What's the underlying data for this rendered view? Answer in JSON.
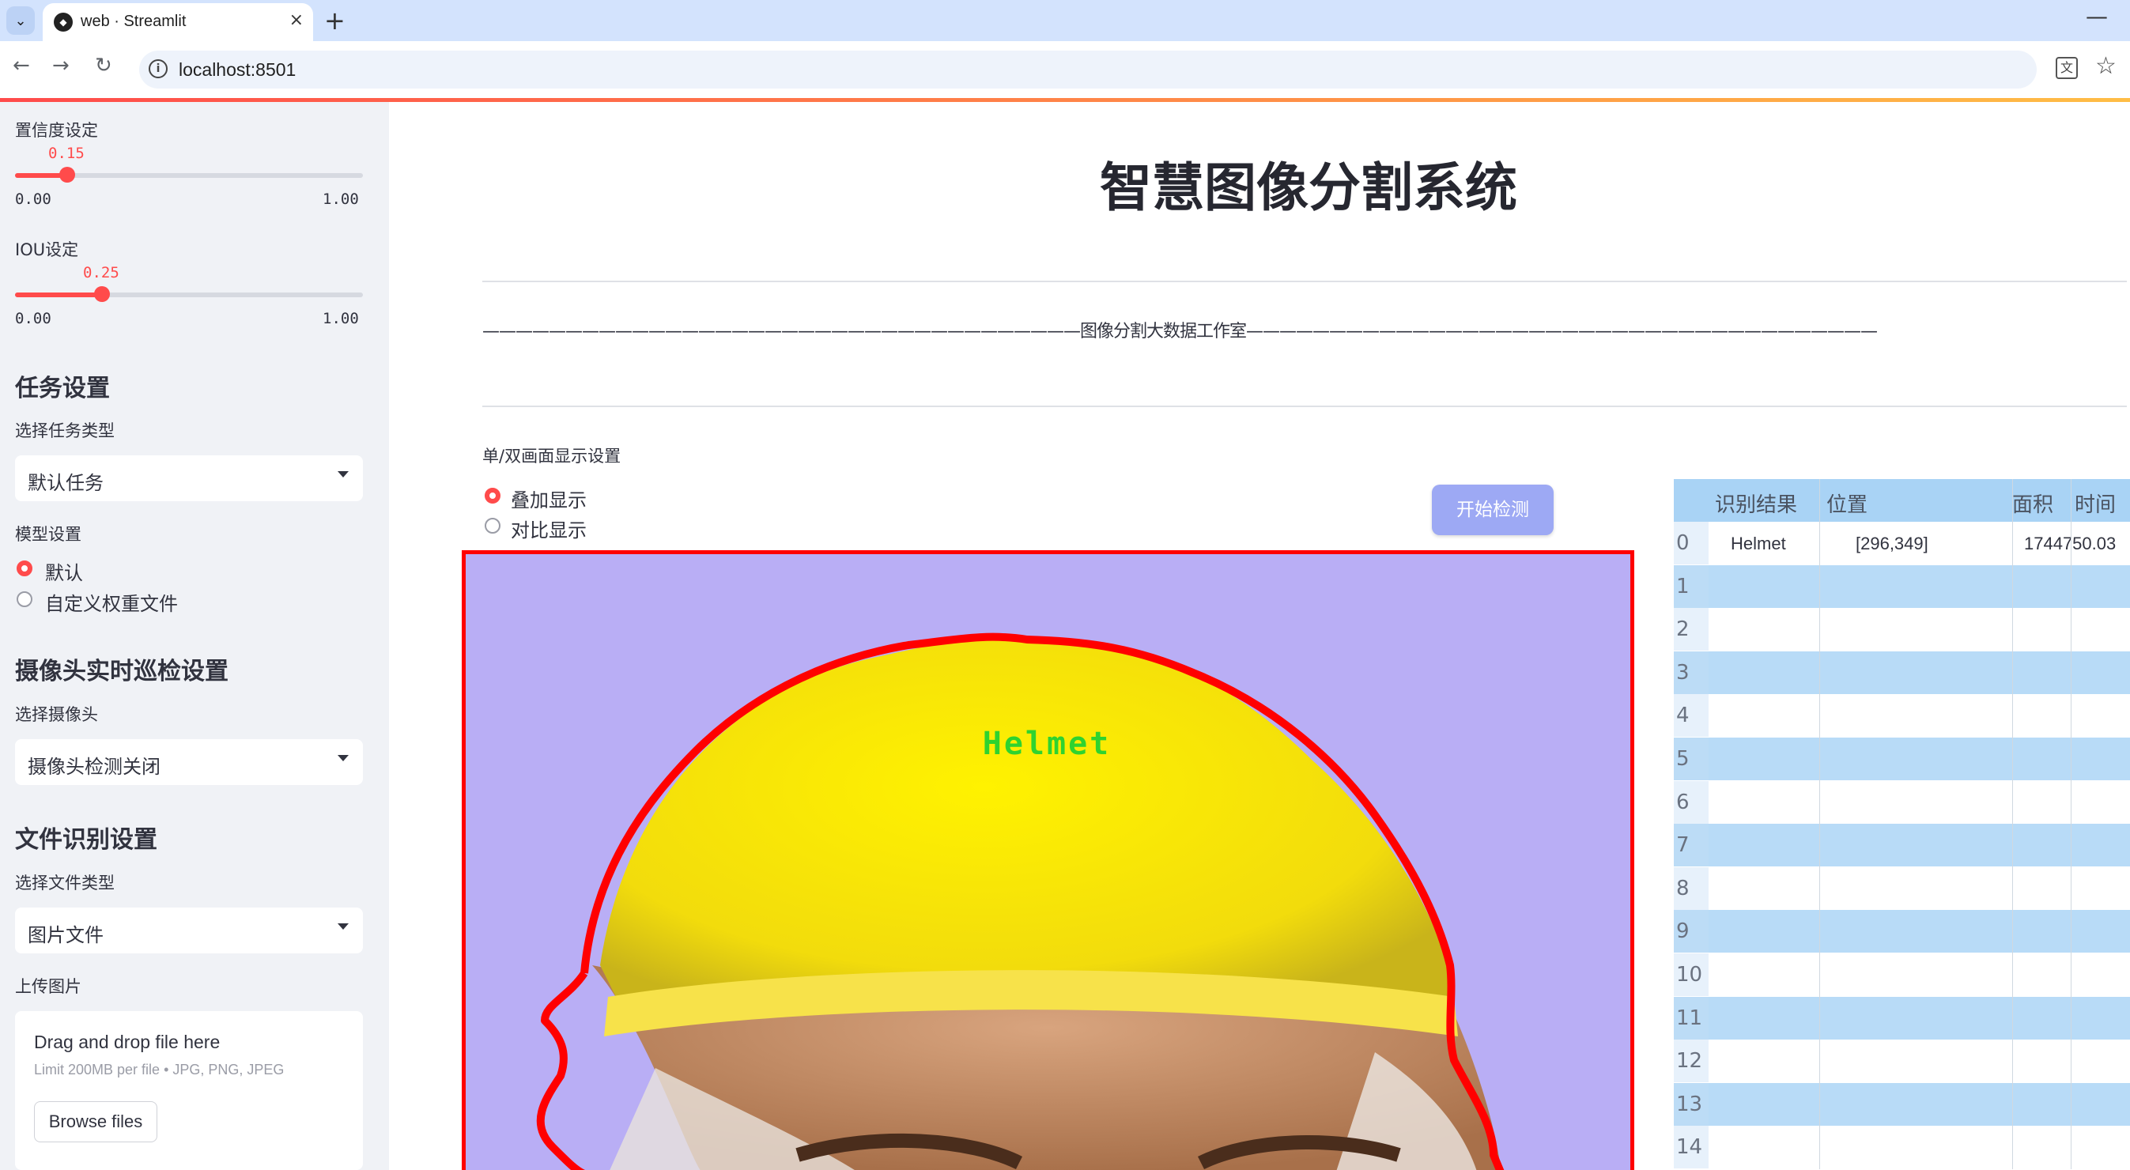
{
  "browser": {
    "tab_title": "web · Streamlit",
    "url": "localhost:8501",
    "new_tab_symbol": "+",
    "close_symbol": "×"
  },
  "sidebar": {
    "confidence": {
      "label": "置信度设定",
      "value": "0.15",
      "min": "0.00",
      "max": "1.00",
      "fraction": 0.15
    },
    "iou": {
      "label": "IOU设定",
      "value": "0.25",
      "min": "0.00",
      "max": "1.00",
      "fraction": 0.25
    },
    "task_heading": "任务设置",
    "task_type_label": "选择任务类型",
    "task_type_value": "默认任务",
    "model_label": "模型设置",
    "model_options": [
      "默认",
      "自定义权重文件"
    ],
    "model_selected": 0,
    "camera_heading": "摄像头实时巡检设置",
    "camera_label": "选择摄像头",
    "camera_value": "摄像头检测关闭",
    "file_heading": "文件识别设置",
    "file_type_label": "选择文件类型",
    "file_type_value": "图片文件",
    "upload_label": "上传图片",
    "upload_main": "Drag and drop file here",
    "upload_sub": "Limit 200MB per file • JPG, PNG, JPEG",
    "browse_label": "Browse files"
  },
  "main": {
    "title": "智慧图像分割系统",
    "subtitle": "————————————————————————————————————图像分割大数据工作室——————————————————————————————————————",
    "display_label": "单/双画面显示设置",
    "display_options": [
      "叠加显示",
      "对比显示"
    ],
    "display_selected": 0,
    "start_button": "开始检测",
    "detection_label": "Helmet"
  },
  "table": {
    "headers": [
      "识别结果",
      "位置",
      "面积",
      "时间"
    ],
    "rows": [
      {
        "index": "0",
        "result": "Helmet",
        "position": "[296,349]",
        "area": "1744750.03"
      },
      {
        "index": "1"
      },
      {
        "index": "2"
      },
      {
        "index": "3"
      },
      {
        "index": "4"
      },
      {
        "index": "5"
      },
      {
        "index": "6"
      },
      {
        "index": "7"
      },
      {
        "index": "8"
      },
      {
        "index": "9"
      },
      {
        "index": "10"
      },
      {
        "index": "11"
      },
      {
        "index": "12"
      },
      {
        "index": "13"
      },
      {
        "index": "14"
      }
    ]
  },
  "colors": {
    "accent": "#ff4b4b",
    "button": "#9da9f4",
    "segment_outline": "#ff0000",
    "helmet": "#f5e20a",
    "background_image": "#b9aef5",
    "detection_text": "#2fd32f"
  }
}
